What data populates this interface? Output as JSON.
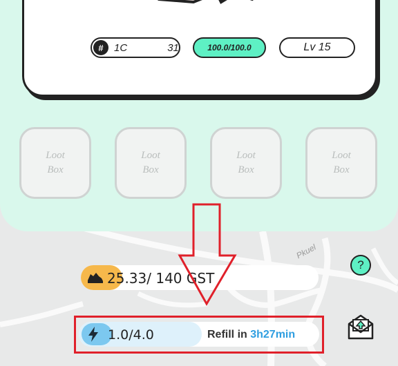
{
  "card": {
    "id_prefix": "1C",
    "id_suffix": "31",
    "hp": "100.0/100.0",
    "level": "Lv 15"
  },
  "loot_boxes": [
    {
      "line1": "Loot",
      "line2": "Box"
    },
    {
      "line1": "Loot",
      "line2": "Box"
    },
    {
      "line1": "Loot",
      "line2": "Box"
    },
    {
      "line1": "Loot",
      "line2": "Box"
    }
  ],
  "map": {
    "street_label": "Pkuel"
  },
  "gst": {
    "text": "25.33/ 140 GST",
    "current": 25.33,
    "max": 140
  },
  "energy": {
    "text": "1.0/4.0",
    "current": 1.0,
    "max": 4.0,
    "refill_label": "Refill in",
    "refill_time": "3h27min"
  },
  "help": {
    "label": "?"
  },
  "colors": {
    "mint": "#d9f8ec",
    "accent": "#5ef0c4",
    "gst": "#f6b84b",
    "energy": "#7cc8ef",
    "refill_time": "#2f9ee0",
    "highlight": "#e0202a"
  },
  "icons": [
    "hash-icon",
    "sneaker-icon",
    "lightning-icon",
    "help-icon",
    "mail-icon",
    "down-arrow-icon"
  ]
}
